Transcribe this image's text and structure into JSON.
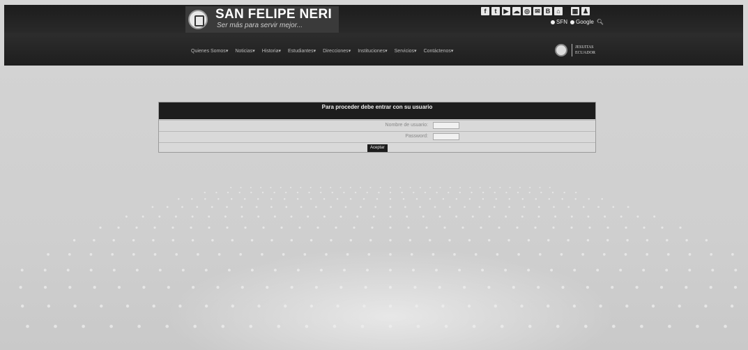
{
  "header": {
    "site_title": "SAN FELIPE NERI",
    "site_subtitle": "Ser más para servir mejor...",
    "social_icons": [
      "facebook-icon",
      "twitter-icon",
      "youtube-icon",
      "soundcloud-icon",
      "instagram-icon",
      "gmail-icon",
      "blogger-icon",
      "home-icon",
      "gallery-icon",
      "user-icon"
    ],
    "social_glyphs": [
      "f",
      "t",
      "▶",
      "☁",
      "◎",
      "✉",
      "B",
      "⌂",
      "▦",
      "♟"
    ],
    "search_options": [
      "SFN",
      "Google"
    ],
    "nav_items": [
      "Quienes Somos",
      "Noticias",
      "Historia",
      "Estudiantes",
      "Direcciones",
      "Instituciones",
      "Servicios",
      "Contáctenos"
    ],
    "jesuit_brand": [
      "JESUITAS",
      "ECUADOR"
    ]
  },
  "form": {
    "title": "Para proceder debe entrar con su usuario",
    "username_label": "Nombre de usuario:",
    "password_label": "Password:",
    "submit_label": "Aceptar"
  }
}
